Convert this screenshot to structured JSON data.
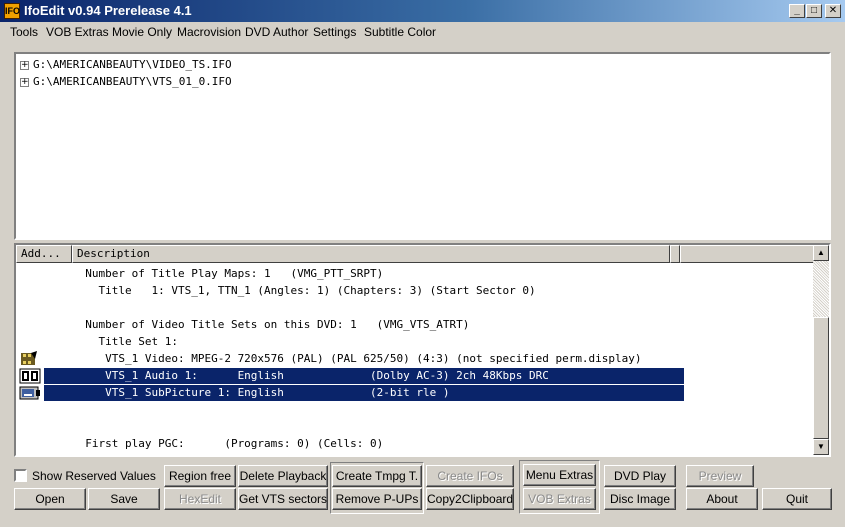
{
  "window": {
    "title": "IfoEdit v0.94 Prerelease 4.1",
    "app_icon": "ifoedit-app-icon",
    "controls": {
      "minimize": "_",
      "maximize": "□",
      "close": "✕"
    }
  },
  "menu": [
    {
      "label": "Tools"
    },
    {
      "label": "VOB Extras"
    },
    {
      "label": "Movie Only"
    },
    {
      "label": "Macrovision"
    },
    {
      "label": "DVD Author"
    },
    {
      "label": "Settings"
    },
    {
      "label": "Subtitle Color"
    }
  ],
  "tree": {
    "expander": "+",
    "items": [
      {
        "label": "G:\\AMERICANBEAUTY\\VIDEO_TS.IFO"
      },
      {
        "label": "G:\\AMERICANBEAUTY\\VTS_01_0.IFO"
      }
    ]
  },
  "list": {
    "columns": {
      "addr": "Add...",
      "desc": "Description"
    },
    "lines": [
      {
        "text": "  Number of Title Play Maps: 1   (VMG_PTT_SRPT)",
        "selected": false,
        "icon": ""
      },
      {
        "text": "    Title   1: VTS_1, TTN_1 (Angles: 1) (Chapters: 3) (Start Sector 0)",
        "selected": false,
        "icon": ""
      },
      {
        "text": "",
        "selected": false,
        "icon": ""
      },
      {
        "text": "  Number of Video Title Sets on this DVD: 1   (VMG_VTS_ATRT)",
        "selected": false,
        "icon": ""
      },
      {
        "text": "    Title Set 1:",
        "selected": false,
        "icon": ""
      },
      {
        "text": "     VTS_1 Video: MPEG-2 720x576 (PAL) (PAL 625/50) (4:3) (not specified perm.display)",
        "selected": false,
        "icon": "video-film-icon"
      },
      {
        "text": "     VTS_1 Audio 1:      English             (Dolby AC-3) 2ch 48Kbps DRC    ",
        "selected": true,
        "icon": "dolby-audio-icon"
      },
      {
        "text": "     VTS_1 SubPicture 1: English             (2-bit rle )                   ",
        "selected": true,
        "icon": "subpicture-icon"
      },
      {
        "text": "",
        "selected": false,
        "icon": ""
      },
      {
        "text": "",
        "selected": false,
        "icon": ""
      },
      {
        "text": "  First play PGC:      (Programs: 0) (Cells: 0)",
        "selected": false,
        "icon": ""
      }
    ]
  },
  "footer": {
    "show_reserved": {
      "label": "Show Reserved Values",
      "checked": false
    },
    "buttons": {
      "open": "Open",
      "save": "Save",
      "region_free": "Region free",
      "hex_edit": "HexEdit",
      "delete_playback": "Delete Playback",
      "get_vts_sectors": "Get VTS sectors",
      "create_tmpg": "Create Tmpg T.",
      "remove_pups": "Remove P-UPs",
      "create_ifos": "Create IFOs",
      "copy2clipboard": "Copy2Clipboard",
      "menu_extras": "Menu Extras",
      "vob_extras": "VOB Extras",
      "dvd_play": "DVD Play",
      "disc_image": "Disc Image",
      "preview": "Preview",
      "about": "About",
      "quit": "Quit"
    }
  },
  "colors": {
    "selection": "#0a246a",
    "face": "#d4d0c8",
    "titlebar_start": "#0a246a",
    "titlebar_end": "#a6caf0"
  }
}
